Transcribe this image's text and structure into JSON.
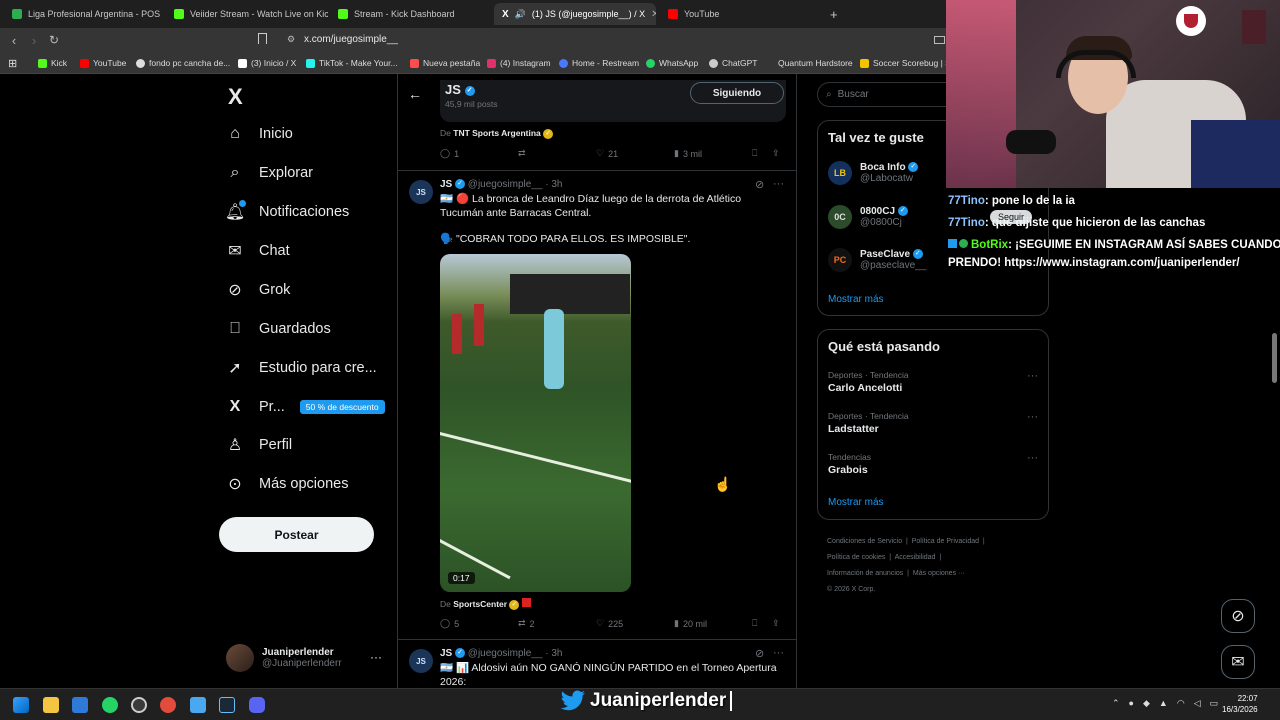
{
  "browser": {
    "tabs": [
      {
        "label": "Liga Profesional Argentina - POSICIO",
        "color": "#2eae4f",
        "active": false
      },
      {
        "label": "Veiider Stream - Watch Live on Kick",
        "color": "#53fc18",
        "active": false
      },
      {
        "label": "Stream - Kick Dashboard",
        "color": "#53fc18",
        "active": false
      },
      {
        "label": "(1) JS (@juegosimple__) / X",
        "color": "#ffffff",
        "active": true
      },
      {
        "label": "YouTube",
        "color": "#ff0000",
        "active": false
      }
    ],
    "new_tab": "+",
    "url": "x.com/juegosimple__",
    "bookmarks": [
      {
        "label": "Kick",
        "color": "#53fc18"
      },
      {
        "label": "YouTube",
        "color": "#ff0000"
      },
      {
        "label": "fondo pc cancha de...",
        "color": "#dddddd"
      },
      {
        "label": "(3) Inicio / X",
        "color": "#ffffff"
      },
      {
        "label": "TikTok - Make Your...",
        "color": "#25f4ee"
      },
      {
        "label": "Nueva pestaña",
        "color": "#ff4d4d"
      },
      {
        "label": "(4) Instagram",
        "color": "#e1306c"
      },
      {
        "label": "Home - Restream",
        "color": "#4a78ff"
      },
      {
        "label": "WhatsApp",
        "color": "#25d366"
      },
      {
        "label": "ChatGPT",
        "color": "#cccccc"
      },
      {
        "label": "Quantum Hardstore",
        "color": "#888888"
      },
      {
        "label": "Soccer Scorebug | S...",
        "color": "#f5c400"
      }
    ]
  },
  "nav": {
    "logo": "X",
    "items": [
      {
        "label": "Inicio",
        "icon": "home-icon"
      },
      {
        "label": "Explorar",
        "icon": "search-icon"
      },
      {
        "label": "Notificaciones",
        "icon": "bell-icon"
      },
      {
        "label": "Chat",
        "icon": "mail-icon"
      },
      {
        "label": "Grok",
        "icon": "grok-icon"
      },
      {
        "label": "Guardados",
        "icon": "bookmark-icon"
      },
      {
        "label": "Estudio para cre...",
        "icon": "rocket-icon"
      },
      {
        "label": "Pr...",
        "icon": "x-icon"
      },
      {
        "label": "Perfil",
        "icon": "person-icon"
      },
      {
        "label": "Más opciones",
        "icon": "more-circle-icon"
      }
    ],
    "premium_badge": "50 % de descuento",
    "post_button": "Postear",
    "account": {
      "name": "Juaniperlender",
      "handle": "@Juaniperlenderr"
    }
  },
  "profile_header": {
    "name": "JS",
    "posts": "45,9 mil posts",
    "follow_button": "Siguiendo"
  },
  "tweets": [
    {
      "source_prefix": "De",
      "source": "TNT Sports Argentina",
      "replies": "1",
      "retweets": "",
      "likes": "21",
      "views": "3 mil"
    },
    {
      "name": "JS",
      "handle": "@juegosimple__",
      "time": "· 3h",
      "text1": "🇦🇷 🔴 La bronca de Leandro Díaz luego de la derrota de Atlético Tucumán ante Barracas Central.",
      "text2": "🗣️ \"COBRAN TODO PARA ELLOS. ES IMPOSIBLE\".",
      "video_duration": "0:17",
      "source_prefix": "De",
      "source": "SportsCenter",
      "replies": "5",
      "retweets": "2",
      "likes": "225",
      "views": "20 mil"
    },
    {
      "name": "JS",
      "handle": "@juegosimple__",
      "time": "· 3h",
      "text1": "🇦🇷 📊 Aldosivi aún NO GANÓ NINGÚN PARTIDO en el Torneo Apertura 2026:"
    }
  ],
  "sidebar": {
    "search_placeholder": "Buscar",
    "suggest_title": "Tal vez te guste",
    "suggestions": [
      {
        "name": "Boca Info",
        "handle": "@Labocatw",
        "initials": "LB"
      },
      {
        "name": "0800CJ",
        "handle": "@0800Cj",
        "initials": "0C"
      },
      {
        "name": "PaseClave",
        "handle": "@paseclave__",
        "initials": "PC"
      }
    ],
    "follow_label": "Seguir",
    "show_more": "Mostrar más",
    "trends_title": "Qué está pasando",
    "trends": [
      {
        "context": "Deportes · Tendencia",
        "name": "Carlo Ancelotti"
      },
      {
        "context": "Deportes · Tendencia",
        "name": "Ladstatter"
      },
      {
        "context": "Tendencias",
        "name": "Grabois"
      }
    ],
    "footer": [
      "Condiciones de Servicio",
      "Política de Privacidad",
      "Política de cookies",
      "Accesibilidad",
      "Información de anuncios",
      "Más opciones ···",
      "© 2026 X Corp."
    ]
  },
  "stream_chat": [
    {
      "user": "77Tino",
      "text": ": pone lo de la ia"
    },
    {
      "user": "77Tino",
      "text": ": que dijiste que hicieron de las canchas"
    },
    {
      "user": "BotRix",
      "text": ": ¡SEGUIME EN INSTAGRAM ASÍ SABES CUANDO"
    },
    {
      "user": "",
      "text": "PRENDO! https://www.instagram.com/juaniperlender/"
    }
  ],
  "taskbar": {
    "overlay_name": "Juaniperlender",
    "time": "22:07",
    "date": "16/3/2026"
  }
}
